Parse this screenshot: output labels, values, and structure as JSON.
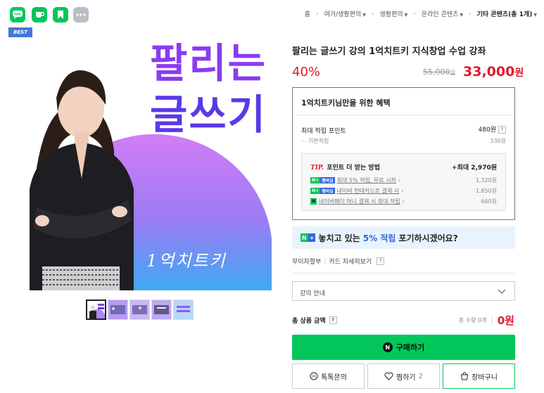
{
  "share": {
    "icons": [
      "talk-icon",
      "cafe-icon",
      "bookmark-icon",
      "more-icon"
    ],
    "colors": {
      "green": "#03c75a",
      "gray": "#b9bec7"
    }
  },
  "breadcrumb": {
    "items": [
      {
        "label": "홈",
        "dropdown": false
      },
      {
        "label": "여가/생활편의",
        "dropdown": true
      },
      {
        "label": "생활편의",
        "dropdown": true
      },
      {
        "label": "온라인 콘텐츠",
        "dropdown": true
      },
      {
        "label": "기타 콘텐츠(총 1개)",
        "dropdown": true,
        "current": true
      }
    ]
  },
  "gallery": {
    "badge": "BEST",
    "hero_line1": "팔리는",
    "hero_line2": "글쓰기",
    "signature": "1억치트키",
    "thumb_count": 5
  },
  "product": {
    "title": "팔리는 글쓰기 강의 1억치트키 지식창업 수업 강좌",
    "discount": "40%",
    "original_price": "55,000",
    "original_unit": "원",
    "price": "33,000",
    "price_unit": "원"
  },
  "benefit": {
    "header": "1억치트키님만을 위한 혜택",
    "max_point_label": "최대 적립 포인트",
    "max_point_value": "480원",
    "help": "?",
    "base_label": "기본적립",
    "base_value": "330원",
    "tip_tag": "TIP.",
    "tip_title": "포인트 더 받는 방법",
    "tip_max": "+최대 2,970원",
    "tips": [
      {
        "badge": "N + 멤버십",
        "label": "최대 5% 적립, 무료 시작",
        "value": "1,320원"
      },
      {
        "badge": "N + 멤버십",
        "label": "네이버 현대카드로 결제 시",
        "value": "1,650원"
      },
      {
        "badge": "N",
        "label": "네이버페이 머니 결제 시 최대 적립",
        "value": "660원"
      }
    ]
  },
  "banner": {
    "text_before": "놓치고 있는",
    "highlight": "5% 적립",
    "text_after": "포기하시겠어요?",
    "badge_n": "N",
    "badge_plus": "+"
  },
  "card": {
    "installment": "무이자할부",
    "details": "카드 자세히보기",
    "help": "?"
  },
  "option": {
    "selected": "강의 안내"
  },
  "total": {
    "label": "총 상품 금액",
    "help": "?",
    "qty": "총 수량 0개",
    "amount": "0원"
  },
  "actions": {
    "buy_icon": "N",
    "buy": "구매하기",
    "inquiry": "톡톡문의",
    "wish": "찜하기",
    "wish_count": "2",
    "cart": "장바구니"
  }
}
